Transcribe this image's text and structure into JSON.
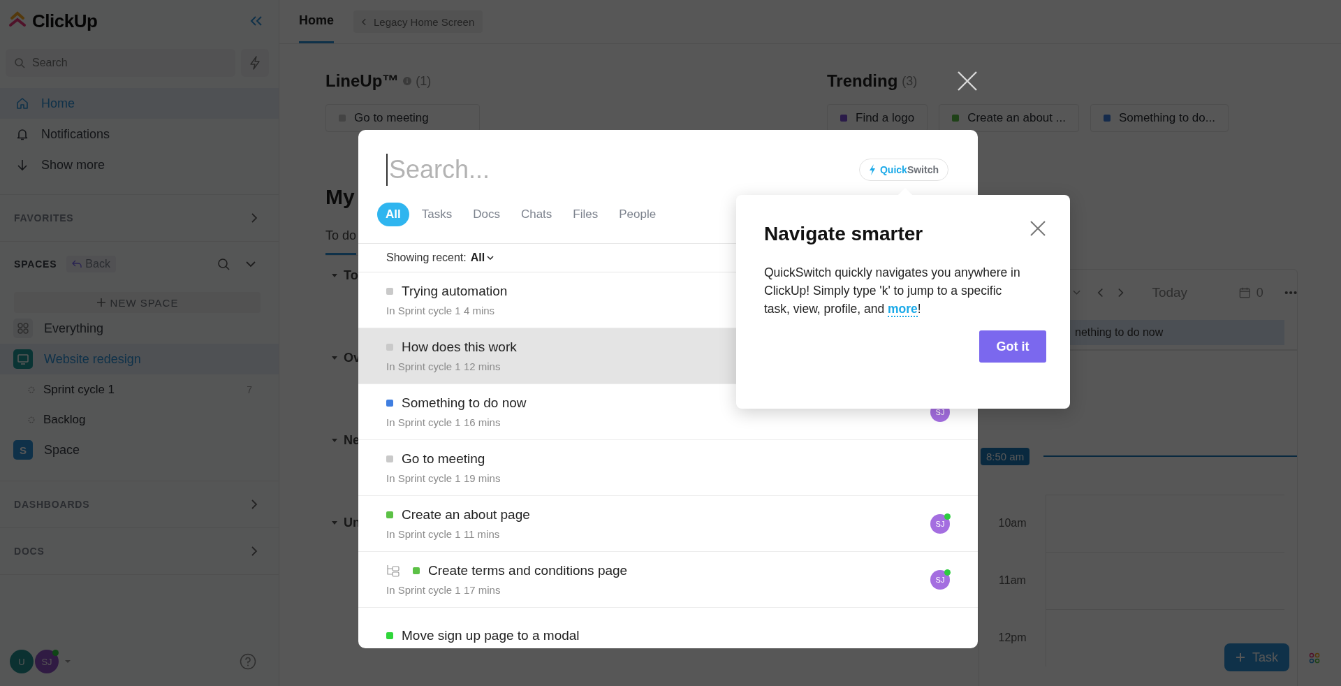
{
  "sidebar": {
    "logo": "ClickUp",
    "search": {
      "placeholder": "Search"
    },
    "nav": [
      {
        "label": "Home",
        "kind": "home",
        "selected": true
      },
      {
        "label": "Notifications",
        "kind": "bell",
        "selected": false
      },
      {
        "label": "Show more",
        "kind": "arrow-down",
        "selected": false
      }
    ],
    "favorites": {
      "title": "FAVORITES"
    },
    "spaces": {
      "title": "SPACES",
      "back": "Back",
      "new_space": "NEW SPACE",
      "items": [
        {
          "label": "Everything",
          "kind": "everything",
          "selected": false
        },
        {
          "label": "Website redesign",
          "kind": "monitor",
          "selected": true,
          "children": [
            {
              "label": "Sprint cycle 1",
              "count": "7"
            },
            {
              "label": "Backlog"
            }
          ]
        },
        {
          "label": "Space",
          "kind": "letter",
          "badge": "S",
          "selected": false
        }
      ]
    },
    "dashboards": {
      "title": "DASHBOARDS"
    },
    "docs": {
      "title": "DOCS"
    },
    "avatars": [
      {
        "initials": "U",
        "color": "#0b3131",
        "online": false
      },
      {
        "initials": "SJ",
        "color": "#301b43",
        "online": true
      }
    ]
  },
  "top_bar": {
    "tabs": [
      {
        "label": "Home",
        "selected": true
      }
    ],
    "legacy_button": "Legacy Home Screen"
  },
  "lineup": {
    "title": "LineUp™",
    "count": "(1)",
    "cards": [
      {
        "title": "Go to meeting",
        "color": "#444444"
      }
    ]
  },
  "trending": {
    "title": "Trending",
    "count": "(3)",
    "cards": [
      {
        "title": "Find a logo",
        "color": "#2a1b49"
      },
      {
        "title": "Create an about ...",
        "color": "#1f4218"
      },
      {
        "title": "Something to do...",
        "color": "#152b4c"
      }
    ]
  },
  "my_work": {
    "title": "My",
    "tabs": [
      {
        "label": "To do",
        "selected": true
      }
    ],
    "groups": [
      {
        "label": "To",
        "expanded": true
      },
      {
        "label": "Ov",
        "expanded": true
      },
      {
        "label": "Ne",
        "expanded": true
      },
      {
        "label": "Un",
        "expanded": true
      }
    ]
  },
  "calendar": {
    "today": "Today",
    "count": "0",
    "event": "nething to do now",
    "now": "8:50 am",
    "hours": [
      "10am",
      "11am",
      "12pm"
    ]
  },
  "fab": {
    "label": "Task"
  },
  "search_modal": {
    "placeholder": "Search...",
    "badge": {
      "prefix": "Quick",
      "suffix": "Switch"
    },
    "filters": [
      {
        "label": "All",
        "selected": true
      },
      {
        "label": "Tasks",
        "selected": false
      },
      {
        "label": "Docs",
        "selected": false
      },
      {
        "label": "Chats",
        "selected": false
      },
      {
        "label": "Files",
        "selected": false
      },
      {
        "label": "People",
        "selected": false
      }
    ],
    "recent": {
      "label": "Showing recent:",
      "value": "All"
    },
    "results": [
      {
        "title": "Trying automation",
        "subtitle": "In Sprint cycle 1 4 mins",
        "color": "#c9c9c9",
        "selected": false,
        "subtask": false
      },
      {
        "title": "How does this work",
        "subtitle": "In Sprint cycle 1 12 mins",
        "color": "#c9c9c9",
        "selected": true,
        "subtask": false
      },
      {
        "title": "Something to do now",
        "subtitle": "In Sprint cycle 1 16 mins",
        "color": "#3f7ee0",
        "selected": false,
        "subtask": false,
        "assignee": "SJ"
      },
      {
        "title": "Go to meeting",
        "subtitle": "In Sprint cycle 1 19 mins",
        "color": "#c9c9c9",
        "selected": false,
        "subtask": false
      },
      {
        "title": "Create an about page",
        "subtitle": "In Sprint cycle 1 11 mins",
        "color": "#5cc146",
        "selected": false,
        "subtask": false,
        "assignee": "SJ"
      },
      {
        "title": "Create terms and conditions page",
        "subtitle": "In Sprint cycle 1 17 mins",
        "color": "#5cc146",
        "selected": false,
        "subtask": true,
        "assignee": "SJ"
      },
      {
        "title": "Move sign up page to a modal",
        "color": "#2fd63a",
        "selected": false,
        "subtask": false
      }
    ]
  },
  "popover": {
    "title": "Navigate smarter",
    "text": "QuickSwitch quickly navigates you anywhere in ClickUp! Simply type 'k' to jump to a specific task, view, profile, and ",
    "link": "more",
    "tail": "!",
    "button": "Got it"
  }
}
